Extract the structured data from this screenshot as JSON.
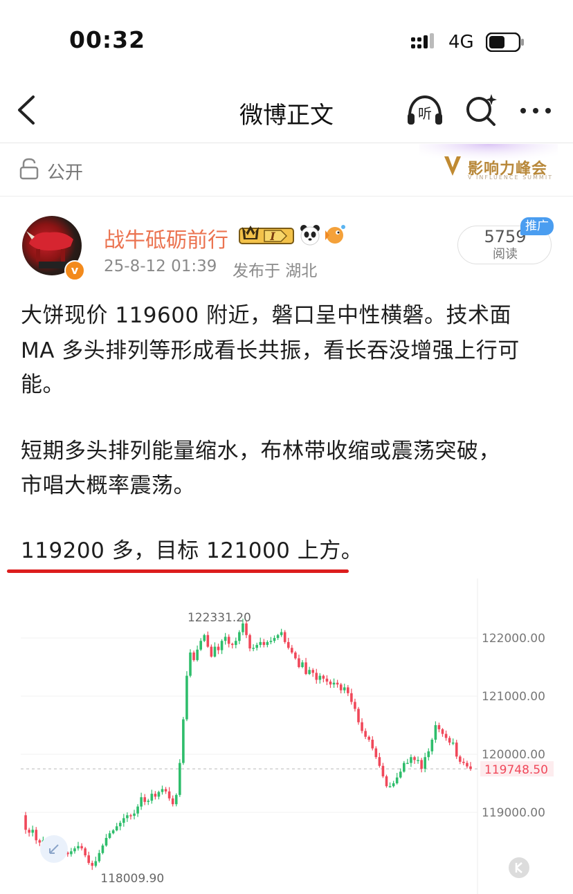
{
  "status_bar": {
    "time": "00:32",
    "network": "4G"
  },
  "nav": {
    "title": "微博正文"
  },
  "visibility": {
    "label": "公开"
  },
  "summit_badge": {
    "title": "影响力峰会",
    "subtitle": "V INFLUENCE SUMMIT",
    "accent": "#b8883a"
  },
  "author": {
    "name": "战牛砥砺前行",
    "verified_mark": "v",
    "vip_level": "I",
    "post_time": "25-8-12 01:39",
    "location": "发布于 湖北"
  },
  "reads": {
    "count": "5759",
    "label": "阅读",
    "promo": "推广"
  },
  "post": {
    "p1": [
      "大饼现价 119600 附近，磐口呈中性横磐。技术面",
      "MA 多头排列等形成看长共振，看长吞没增强上行可",
      "能。"
    ],
    "p2": [
      "短期多头排列能量缩水，布林带收缩或震荡突破，",
      "市唱大概率震荡。"
    ],
    "p3": [
      "119200 多，目标 121000 上方。"
    ]
  },
  "colors": {
    "up": "#2ebd6b",
    "down": "#f0485a",
    "username": "#eb7350",
    "underline": "#dc1d1d"
  },
  "chart_data": {
    "type": "candlestick",
    "y_ticks": [
      "122000.00",
      "121000.00",
      "120000.00",
      "119000.00"
    ],
    "y_tick_values": [
      122000,
      121000,
      120000,
      119000
    ],
    "last_price_label": "119748.50",
    "last_price": 119748.5,
    "high_label": "122331.20",
    "low_label": "118009.90",
    "ylim": [
      117400,
      122800
    ],
    "grid": true,
    "close_path": [
      118950,
      118700,
      118650,
      118700,
      118520,
      118480,
      118520,
      118350,
      118420,
      118380,
      118350,
      118330,
      118310,
      118280,
      118330,
      118380,
      118420,
      118380,
      118260,
      118130,
      118080,
      118160,
      118300,
      118430,
      118560,
      118640,
      118690,
      118760,
      118820,
      118900,
      118950,
      118940,
      118980,
      119100,
      119260,
      119180,
      119200,
      119320,
      119270,
      119350,
      119400,
      119360,
      119240,
      119140,
      119300,
      119850,
      120600,
      121350,
      121750,
      121620,
      121800,
      121950,
      122050,
      121850,
      121680,
      121850,
      121790,
      121950,
      122020,
      121900,
      121880,
      121950,
      122100,
      122250,
      122050,
      121820,
      121830,
      121880,
      121930,
      121880,
      121930,
      121950,
      122000,
      122050,
      122100,
      121930,
      121830,
      121750,
      121650,
      121500,
      121580,
      121380,
      121450,
      121400,
      121280,
      121350,
      121300,
      121250,
      121200,
      121230,
      121200,
      121100,
      121150,
      121050,
      120900,
      120780,
      120550,
      120400,
      120300,
      120250,
      120100,
      119950,
      119800,
      119620,
      119450,
      119450,
      119500,
      119600,
      119700,
      119850,
      119850,
      119950,
      119900,
      119900,
      119750,
      119950,
      120050,
      120250,
      120500,
      120430,
      120350,
      120280,
      120200,
      120200,
      119960,
      119870,
      119850,
      119790,
      119748.5
    ]
  }
}
